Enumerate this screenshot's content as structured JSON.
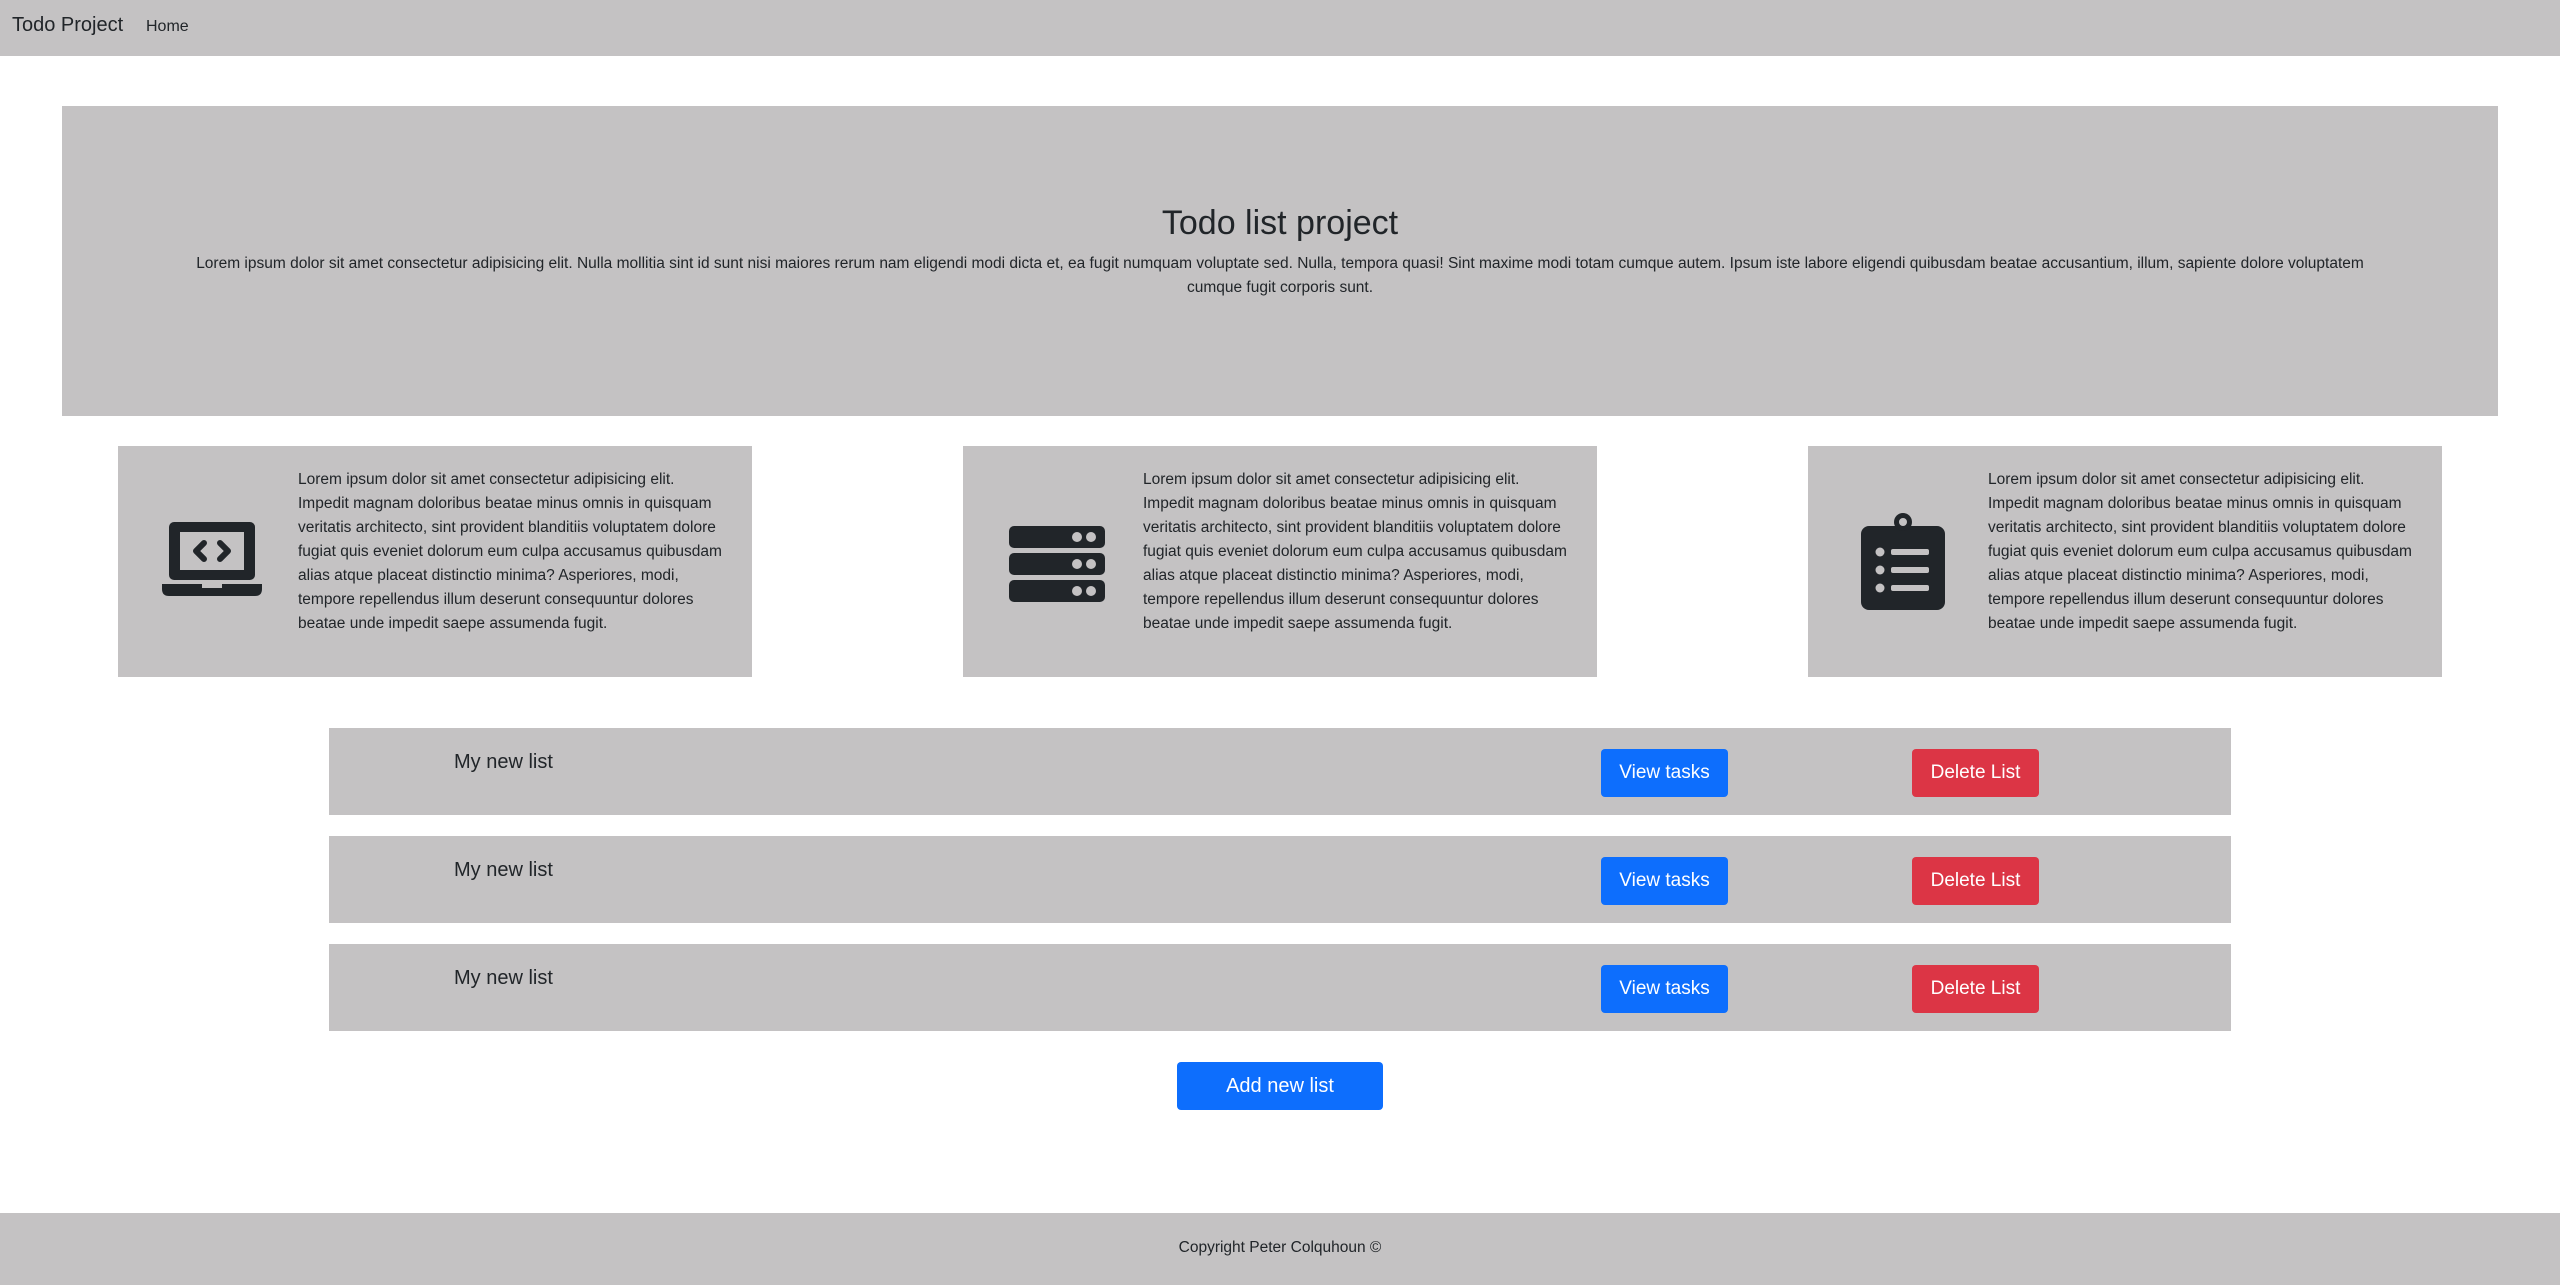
{
  "navbar": {
    "brand": "Todo Project",
    "links": [
      {
        "label": "Home"
      }
    ]
  },
  "hero": {
    "title": "Todo list project",
    "text": "Lorem ipsum dolor sit amet consectetur adipisicing elit. Nulla mollitia sint id sunt nisi maiores rerum nam eligendi modi dicta et, ea fugit numquam voluptate sed. Nulla, tempora quasi! Sint maxime modi totam cumque autem. Ipsum iste labore eligendi quibusdam beatae accusantium, illum, sapiente dolore voluptatem cumque fugit corporis sunt."
  },
  "features": [
    {
      "icon": "laptop-code-icon",
      "text": "Lorem ipsum dolor sit amet consectetur adipisicing elit. Impedit magnam doloribus beatae minus omnis in quisquam veritatis architecto, sint provident blanditiis voluptatem dolore fugiat quis eveniet dolorum eum culpa accusamus quibusdam alias atque placeat distinctio minima? Asperiores, modi, tempore repellendus illum deserunt consequuntur dolores beatae unde impedit saepe assumenda fugit."
    },
    {
      "icon": "server-icon",
      "text": "Lorem ipsum dolor sit amet consectetur adipisicing elit. Impedit magnam doloribus beatae minus omnis in quisquam veritatis architecto, sint provident blanditiis voluptatem dolore fugiat quis eveniet dolorum eum culpa accusamus quibusdam alias atque placeat distinctio minima? Asperiores, modi, tempore repellendus illum deserunt consequuntur dolores beatae unde impedit saepe assumenda fugit."
    },
    {
      "icon": "clipboard-list-icon",
      "text": "Lorem ipsum dolor sit amet consectetur adipisicing elit. Impedit magnam doloribus beatae minus omnis in quisquam veritatis architecto, sint provident blanditiis voluptatem dolore fugiat quis eveniet dolorum eum culpa accusamus quibusdam alias atque placeat distinctio minima? Asperiores, modi, tempore repellendus illum deserunt consequuntur dolores beatae unde impedit saepe assumenda fugit."
    }
  ],
  "lists": [
    {
      "title": "My new list",
      "view_label": "View tasks",
      "delete_label": "Delete List"
    },
    {
      "title": "My new list",
      "view_label": "View tasks",
      "delete_label": "Delete List"
    },
    {
      "title": "My new list",
      "view_label": "View tasks",
      "delete_label": "Delete List"
    }
  ],
  "add_button_label": "Add new list",
  "footer": {
    "text": "Copyright Peter Colquhoun ©"
  },
  "colors": {
    "panel_bg": "#c4c2c3",
    "primary": "#0d6efd",
    "danger": "#dc3545",
    "text": "#212529",
    "icon": "#212529"
  }
}
